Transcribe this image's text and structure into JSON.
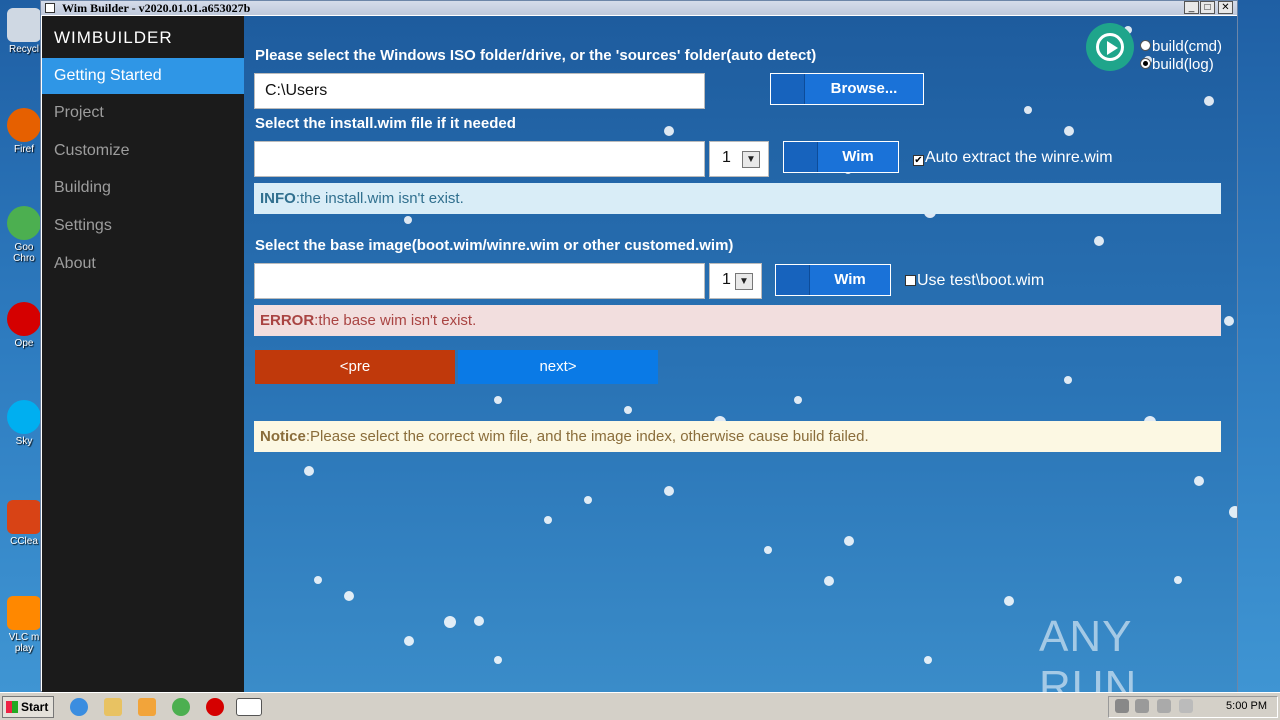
{
  "window": {
    "title": "Wim Builder - v2020.01.01.a653027b"
  },
  "titlebar_buttons": {
    "minimize": "_",
    "maximize": "□",
    "close": "✕"
  },
  "desktop_icons": [
    "Recycl",
    "Firef",
    "Goo Chro",
    "Ope",
    "Sky",
    "CClea",
    "VLC m play"
  ],
  "sidebar": {
    "brand": "WIMBUILDER",
    "items": [
      {
        "label": "Getting Started",
        "active": true
      },
      {
        "label": "Project"
      },
      {
        "label": "Customize"
      },
      {
        "label": "Building"
      },
      {
        "label": "Settings"
      },
      {
        "label": "About"
      }
    ]
  },
  "build_options": {
    "cmd_label": "build(cmd)",
    "log_label": "build(log)",
    "selected": "build(log)"
  },
  "iso": {
    "label": "Please select the Windows ISO folder/drive, or the 'sources' folder(auto detect)",
    "value": "C:\\Users",
    "browse_label": "Browse..."
  },
  "install_wim": {
    "label": "Select the install.wim file if it needed",
    "value": "",
    "index": "1",
    "button_label": "Wim",
    "checkbox_label": "Auto extract the winre.wim",
    "checked": true,
    "info_prefix": "INFO",
    "info_text": ":the install.wim isn't exist."
  },
  "base_image": {
    "label": "Select the base image(boot.wim/winre.wim or other customed.wim)",
    "value": "",
    "index": "1",
    "button_label": "Wim",
    "checkbox_label": "Use test\\boot.wim",
    "checked": false,
    "error_prefix": "ERROR",
    "error_text": ":the base wim isn't exist."
  },
  "nav_buttons": {
    "prev": "<pre",
    "next": "next>"
  },
  "notice": {
    "prefix": "Notice",
    "text": ":Please select the correct wim file, and the image index, otherwise cause build failed."
  },
  "watermark": "ANY RUN",
  "taskbar": {
    "start_label": "Start",
    "clock": "5:00 PM"
  },
  "colors": {
    "accent": "#2f96e6",
    "prev_button": "#c0390b",
    "next_button": "#0a7ae6",
    "play_button": "#1fa58b"
  }
}
